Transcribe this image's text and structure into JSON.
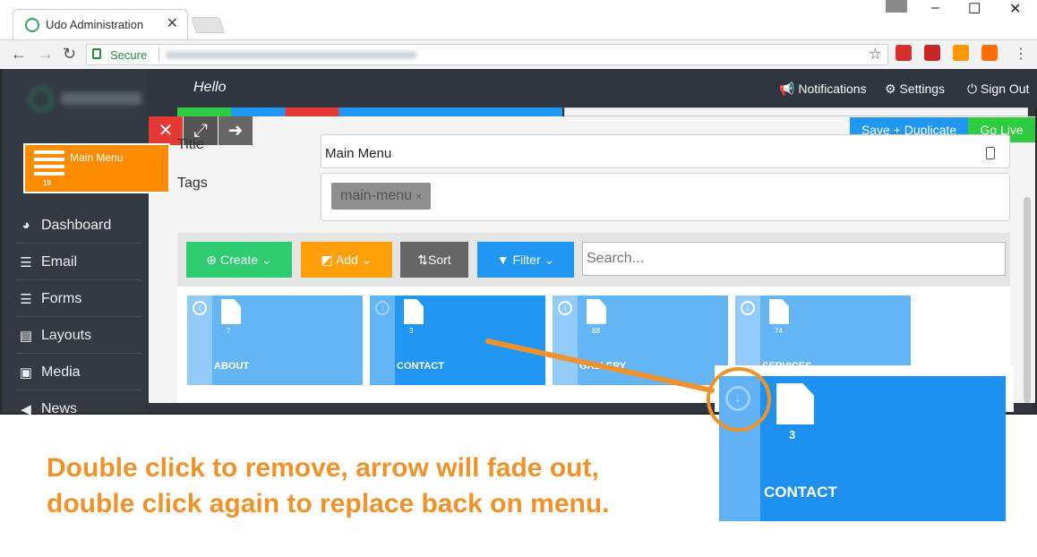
{
  "browser": {
    "tab_title": "Udo Administration",
    "tab_close": "✕",
    "secure_label": "Secure",
    "win_min": "–",
    "win_max": "☐",
    "win_close": "✕"
  },
  "topbar": {
    "hello": "Hello",
    "notifications": "Notifications",
    "settings": "Settings",
    "signout": "Sign Out"
  },
  "sidebar": {
    "menu_tile_label": "Main Menu",
    "menu_tile_count": "19",
    "items": [
      {
        "label": "Dashboard",
        "icon": "dashboard-icon"
      },
      {
        "label": "Email",
        "icon": "list-icon"
      },
      {
        "label": "Forms",
        "icon": "list-icon"
      },
      {
        "label": "Layouts",
        "icon": "newspaper-icon"
      },
      {
        "label": "Media",
        "icon": "image-icon"
      },
      {
        "label": "News",
        "icon": "megaphone-icon"
      }
    ]
  },
  "editor": {
    "title_label": "Title",
    "title_value": "Main Menu",
    "tags_label": "Tags",
    "tag": "main-menu",
    "save_duplicate": "Save + Duplicate",
    "go_live": "Go Live"
  },
  "toolbar": {
    "create": "Create",
    "add": "Add",
    "sort": "Sort",
    "filter": "Filter",
    "search_placeholder": "Search..."
  },
  "tiles": [
    {
      "name": "ABOUT",
      "count": "7"
    },
    {
      "name": "CONTACT",
      "count": "3"
    },
    {
      "name": "GALLERY",
      "count": "88"
    },
    {
      "name": "SERVICES",
      "count": "74"
    }
  ],
  "zoom_tile": {
    "name": "CONTACT",
    "count": "3"
  },
  "caption": {
    "line1": "Double click to remove,  arrow will fade out,",
    "line2": "double click again to replace back on menu."
  },
  "colors": {
    "accent_orange": "#ff8c00",
    "tile_blue": "#2196f3",
    "tile_light_blue": "#64b5f6",
    "go_live_green": "#2ecc40",
    "caption_orange": "#f0922c"
  }
}
